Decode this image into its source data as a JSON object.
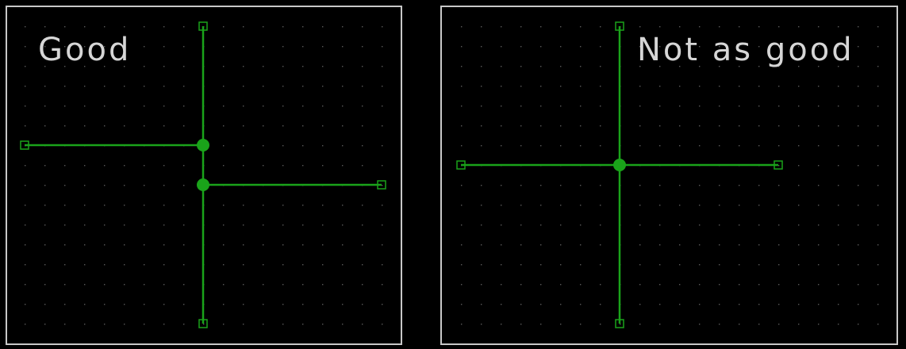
{
  "panels": [
    {
      "title": "Good"
    },
    {
      "title": "Not as good"
    }
  ],
  "colors": {
    "background": "#000000",
    "frame": "#c8c8c8",
    "grid": "#5a5a5a",
    "wire": "#1aa31a",
    "text": "#d6d6d6"
  }
}
